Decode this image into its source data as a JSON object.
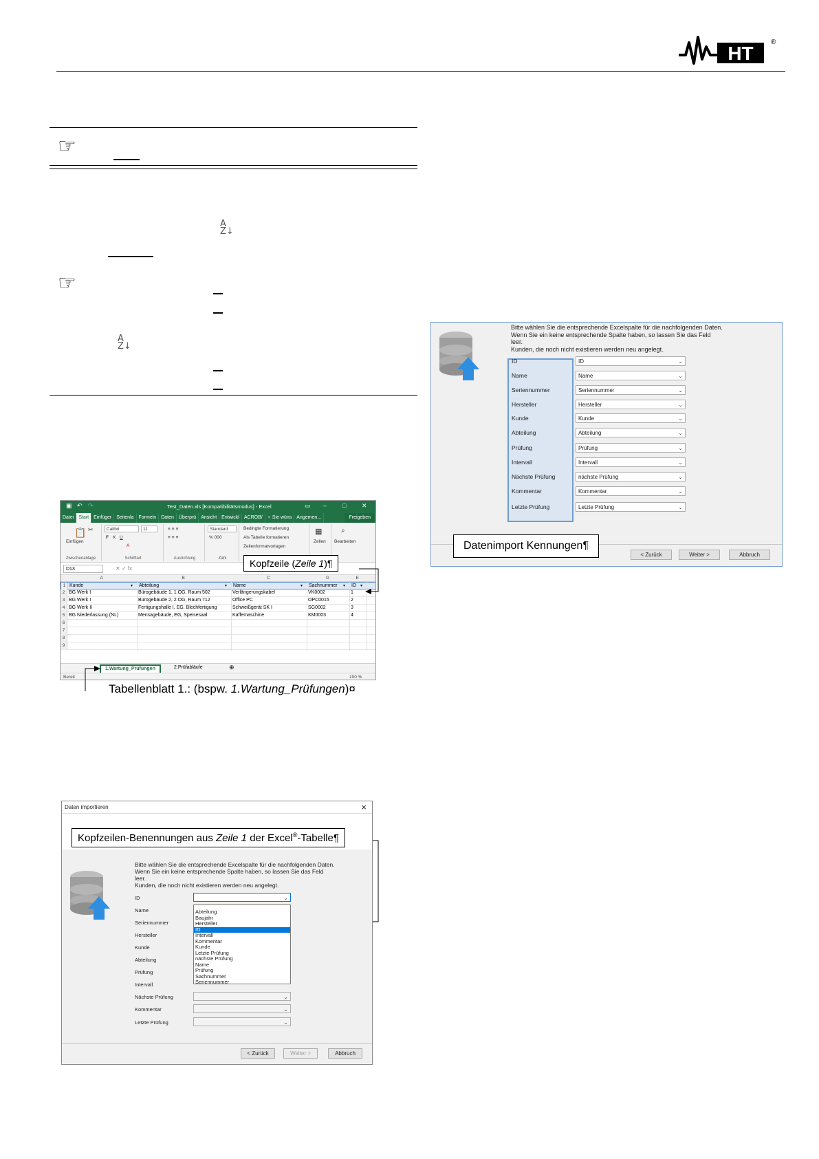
{
  "brand": {
    "logo_text": "HT",
    "registered": "®",
    "accent": "#000000"
  },
  "excel": {
    "title": "Test_Daten.xls [Kompatibilitätsmodus] - Excel",
    "tabs": [
      "Datei",
      "Start",
      "Einfüger",
      "Seitenla",
      "Formeln",
      "Daten",
      "Überprü",
      "Ansicht",
      "Entwickl",
      "ACROB/",
      "♀ Sie wüns",
      "Angemen..."
    ],
    "share": "Freigeben",
    "ribbon": {
      "paste": "Einfügen",
      "clipboard": "Zwischenablage",
      "font_name": "Calibri",
      "font_size": "11",
      "font_group": "Schriftart",
      "align_group": "Ausrichtung",
      "number_format": "Standard",
      "number_group": "Zahl",
      "cond_format": "Bedingte Formatierung",
      "as_table": "Als Tabelle formatieren",
      "cell_styles": "Zellenformatvorlagen",
      "cells": "Zellen",
      "edit": "Bearbeiten"
    },
    "namebox": "D13",
    "columns": [
      "A",
      "B",
      "C",
      "D",
      "E"
    ],
    "headers": [
      "Kunde",
      "Abteilung",
      "Name",
      "Sachnummer",
      "ID"
    ],
    "rows": [
      [
        "BG Werk I",
        "Bürogebäude 1, 1.OG, Raum 502",
        "Verlängerungskabel",
        "VK0002",
        "1"
      ],
      [
        "BG Werk I",
        "Bürogebäude 2, 2.OG, Raum 712",
        "Office PC",
        "OPC0015",
        "2"
      ],
      [
        "BG Werk II",
        "Fertigungshalle I, EG, Blechfertigung",
        "Schweißgerät SK I",
        "SG0002",
        "3"
      ],
      [
        "BG Niederlassung (NL)",
        "Mensagebäude, EG, Speisesaal",
        "Kaffemaschine",
        "KM0003",
        "4"
      ]
    ],
    "row_numbers": [
      "1",
      "2",
      "3",
      "4",
      "5",
      "6",
      "7",
      "8",
      "9"
    ],
    "sheet1": "1.Wartung_Prüfungen",
    "sheet2": "2.Prüfabläufe",
    "status": "Bereit",
    "zoom": "100 %"
  },
  "callouts": {
    "kopfzeile_pre": "Kopfzeile (",
    "kopfzeile_it": "Zeile 1",
    "kopfzeile_post": ")¶",
    "tabellenblatt_pre": "Tabellenblatt 1.: (bspw. ",
    "tabellenblatt_it": "1.Wartung_Prüfungen",
    "tabellenblatt_post": ")¤",
    "kennungen": "Datenimport Kennungen¶",
    "benennungen_pre": "Kopfzeilen-Benennungen aus ",
    "benennungen_it": "Zeile 1",
    "benennungen_mid": " der Excel",
    "benennungen_sup": "®",
    "benennungen_post": "-Tabelle¶"
  },
  "dialog_right": {
    "instruction": [
      "Bitte wählen Sie die entsprechende Excelspalte für die nachfolgenden Daten.",
      "Wenn Sie ein keine entsprechende Spalte haben, so lassen Sie das Feld",
      "leer.",
      "Kunden, die noch nicht existieren werden neu angelegt."
    ],
    "fields": [
      {
        "label": "ID",
        "value": "ID"
      },
      {
        "label": "Name",
        "value": "Name"
      },
      {
        "label": "Seriennummer",
        "value": "Seriennummer"
      },
      {
        "label": "Hersteller",
        "value": "Hersteller"
      },
      {
        "label": "Kunde",
        "value": "Kunde"
      },
      {
        "label": "Abteilung",
        "value": "Abteilung"
      },
      {
        "label": "Prüfung",
        "value": "Prüfung"
      },
      {
        "label": "Intervall",
        "value": "Intervall"
      },
      {
        "label": "Nächste Prüfung",
        "value": "nächste Prüfung"
      },
      {
        "label": "Kommentar",
        "value": "Kommentar"
      },
      {
        "label": "Letzte Prüfung",
        "value": "Letzte Prüfung"
      }
    ],
    "back": "< Zurück",
    "next": "Weiter >",
    "cancel": "Abbruch"
  },
  "dialog_left": {
    "title": "Daten importieren",
    "close": "×",
    "instruction": [
      "Bitte wählen Sie die entsprechende Excelspalte für die nachfolgenden Daten.",
      "Wenn Sie ein keine entsprechende Spalte haben, so lassen Sie das Feld",
      "leer.",
      "Kunden, die noch nicht existieren werden neu angelegt."
    ],
    "fields": [
      "ID",
      "Name",
      "Seriennummer",
      "Hersteller",
      "Kunde",
      "Abteilung",
      "Prüfung",
      "Intervall",
      "Nächste Prüfung",
      "Kommentar",
      "Letzte Prüfung"
    ],
    "options": [
      "Abteilung",
      "Baujahr",
      "Hersteller",
      "ID",
      "Intervall",
      "Kommentar",
      "Kunde",
      "Letzte Prüfung",
      "nächste Prüfung",
      "Name",
      "Prüfung",
      "Sachnummer",
      "Seriennummer"
    ],
    "selected_option": "ID",
    "back": "< Zurück",
    "next": "Weiter >",
    "cancel": "Abbruch"
  }
}
